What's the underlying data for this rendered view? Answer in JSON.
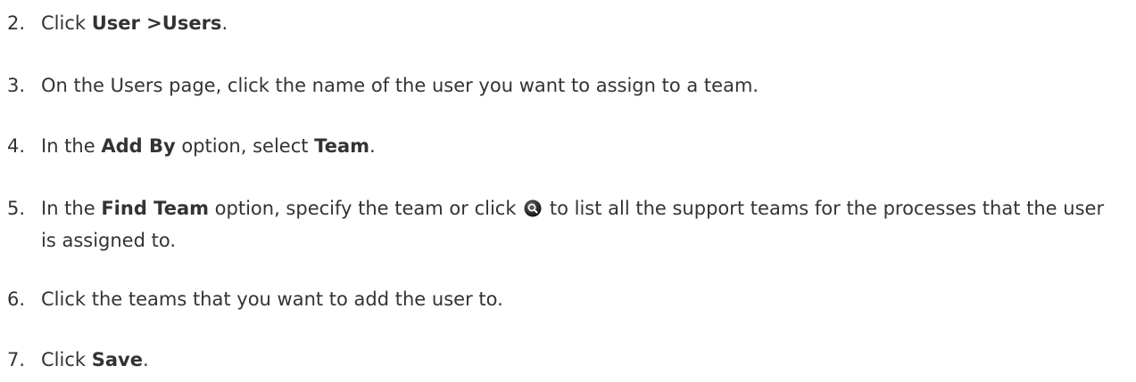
{
  "steps": [
    {
      "number": "2.",
      "parts": [
        {
          "text": "Click "
        },
        {
          "text": "User >Users",
          "bold": true
        },
        {
          "text": "."
        }
      ]
    },
    {
      "number": "3.",
      "parts": [
        {
          "text": "On the Users page, click the name of the user you want to assign to a team."
        }
      ]
    },
    {
      "number": "4.",
      "parts": [
        {
          "text": "In the "
        },
        {
          "text": "Add By",
          "bold": true
        },
        {
          "text": " option, select "
        },
        {
          "text": "Team",
          "bold": true
        },
        {
          "text": "."
        }
      ]
    },
    {
      "number": "5.",
      "parts": [
        {
          "text": "In the "
        },
        {
          "text": "Find Team",
          "bold": true
        },
        {
          "text": " option, specify the team or click "
        },
        {
          "icon": "search-icon"
        },
        {
          "text": " to list all the support teams for the processes that the user is assigned to."
        }
      ]
    },
    {
      "number": "6.",
      "parts": [
        {
          "text": "Click the teams that you want to add the user to."
        }
      ]
    },
    {
      "number": "7.",
      "parts": [
        {
          "text": "Click "
        },
        {
          "text": "Save",
          "bold": true
        },
        {
          "text": "."
        }
      ]
    }
  ]
}
